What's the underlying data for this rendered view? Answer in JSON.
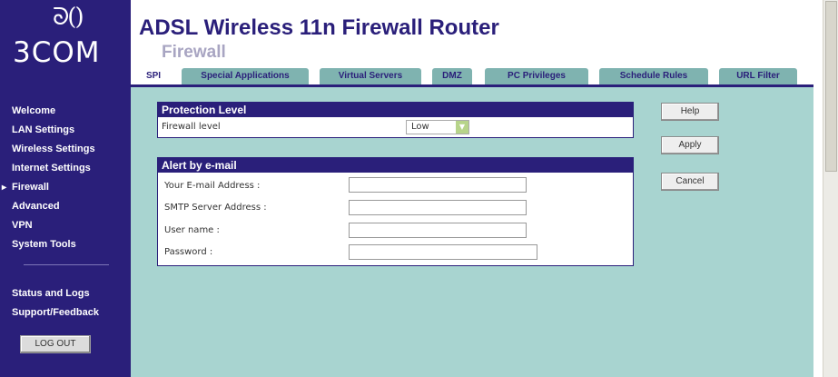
{
  "logo": {
    "mark": "ᘐ()",
    "text": "3COM"
  },
  "header": {
    "title": "ADSL Wireless 11n Firewall Router",
    "subtitle": "Firewall"
  },
  "sidebar": {
    "items": [
      {
        "label": "Welcome",
        "active": false
      },
      {
        "label": "LAN Settings",
        "active": false
      },
      {
        "label": "Wireless Settings",
        "active": false
      },
      {
        "label": "Internet Settings",
        "active": false
      },
      {
        "label": "Firewall",
        "active": true
      },
      {
        "label": "Advanced",
        "active": false
      },
      {
        "label": "VPN",
        "active": false
      },
      {
        "label": "System Tools",
        "active": false
      },
      {
        "label": "Status and Logs",
        "active": false
      },
      {
        "label": "Support/Feedback",
        "active": false
      }
    ],
    "logout_label": "LOG OUT"
  },
  "tabs": [
    {
      "label": "SPI",
      "active": true
    },
    {
      "label": "Special Applications",
      "active": false
    },
    {
      "label": "Virtual Servers",
      "active": false
    },
    {
      "label": "DMZ",
      "active": false
    },
    {
      "label": "PC Privileges",
      "active": false
    },
    {
      "label": "Schedule Rules",
      "active": false
    },
    {
      "label": "URL Filter",
      "active": false
    }
  ],
  "protection": {
    "title": "Protection Level",
    "firewall_label": "Firewall level",
    "firewall_value": "Low"
  },
  "alert": {
    "title": "Alert by e-mail",
    "email_label": "Your E-mail Address :",
    "smtp_label": "SMTP Server Address :",
    "user_label": "User name :",
    "password_label": "Password :"
  },
  "buttons": {
    "help": "Help",
    "apply": "Apply",
    "cancel": "Cancel"
  },
  "colors": {
    "brand": "#2a1f7a",
    "content_bg": "#a8d4d0",
    "tab_bg": "#7fb3b0"
  }
}
